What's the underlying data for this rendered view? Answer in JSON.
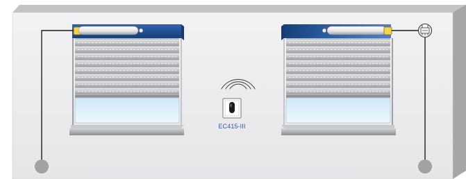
{
  "device": {
    "model_label": "EC415-III",
    "icon": "wireless-transmitter-icon"
  },
  "left_shutter": {
    "icon": "roller-shutter-icon",
    "motor_icon": "tubular-motor-icon",
    "power_icon": "power-connection-icon"
  },
  "right_shutter": {
    "icon": "roller-shutter-icon",
    "motor_icon": "tubular-motor-icon",
    "power_icon": "power-connection-icon",
    "receiver_icon": "control-receiver-icon"
  },
  "colors": {
    "wall_face": "#ececee",
    "wall_top": "#c7c7ca",
    "wall_side": "#a9a9ac",
    "box_blue": "#1f4f92",
    "slat": "#c9cbcd",
    "glass": "#d6ecf8",
    "label_blue": "#2a5a9a"
  }
}
